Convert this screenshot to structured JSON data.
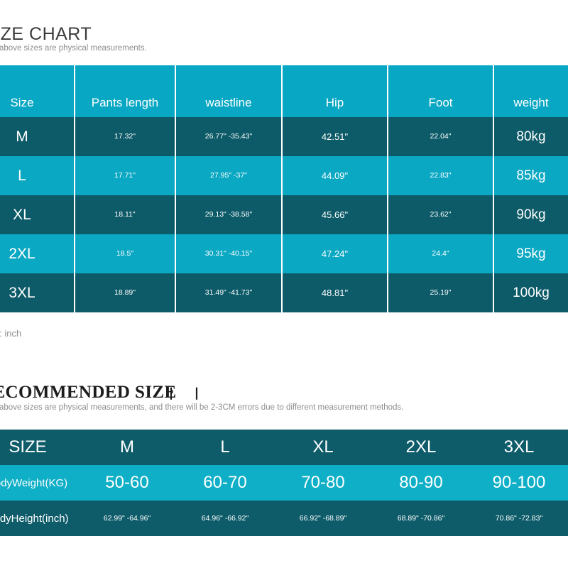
{
  "size_chart": {
    "title": "SIZE CHART",
    "note": "The above sizes are physical measurements.",
    "unit_note": "Unit: inch",
    "headers": [
      "Size",
      "Pants length",
      "waistline",
      "Hip",
      "Foot",
      "weight"
    ],
    "rows": [
      {
        "size": "M",
        "pants_length": "17.32\"",
        "waistline": "26.77\" -35.43\"",
        "hip": "42.51\"",
        "foot": "22.04\"",
        "weight": "80kg"
      },
      {
        "size": "L",
        "pants_length": "17.71\"",
        "waistline": "27.95\" -37\"",
        "hip": "44.09\"",
        "foot": "22.83\"",
        "weight": "85kg"
      },
      {
        "size": "XL",
        "pants_length": "18.11\"",
        "waistline": "29.13\" -38.58\"",
        "hip": "45.66\"",
        "foot": "23.62\"",
        "weight": "90kg"
      },
      {
        "size": "2XL",
        "pants_length": "18.5\"",
        "waistline": "30.31\" -40.15\"",
        "hip": "47.24\"",
        "foot": "24.4\"",
        "weight": "95kg"
      },
      {
        "size": "3XL",
        "pants_length": "18.89\"",
        "waistline": "31.49\" -41.73\"",
        "hip": "48.81\"",
        "foot": "25.19\"",
        "weight": "100kg"
      }
    ]
  },
  "recommended": {
    "title": "RECOMMENDED SIZE",
    "title_marks": "丨丨",
    "note": "The above sizes are physical measurements, and there will be 2-3CM errors due to different measurement methods.",
    "row_labels": [
      "SIZE",
      "BodyWeight(KG)",
      "BodyHeight(inch)"
    ],
    "sizes": [
      "M",
      "L",
      "XL",
      "2XL",
      "3XL"
    ],
    "body_weight": [
      "50-60",
      "60-70",
      "70-80",
      "80-90",
      "90-100"
    ],
    "body_height": [
      "62.99\" -64.96\"",
      "64.96\" -66.92\"",
      "66.92\" -68.89\"",
      "68.89\" -70.86\"",
      "70.86\" -72.83\""
    ]
  },
  "colors": {
    "header_cyan": "#08A7C3",
    "row_dark": "#0D5A68",
    "row_light": "#0BA8C3",
    "table_two_dark": "#0E5C6A",
    "table_two_light": "#0FAFC7",
    "text_white": "#FFFFFF",
    "note_gray": "#8D8D8D",
    "title_dark": "#3B3B3B"
  }
}
